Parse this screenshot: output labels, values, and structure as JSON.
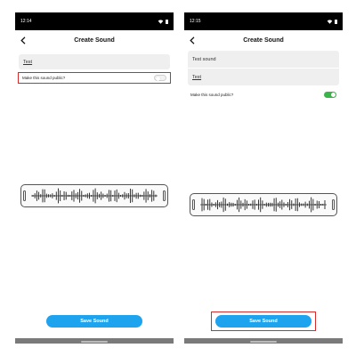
{
  "screens": [
    {
      "status": {
        "time": "12:14"
      },
      "nav": {
        "title": "Create Sound"
      },
      "name_field": {
        "value": "Test"
      },
      "public_toggle": {
        "label": "Make this sound public?",
        "state": "off"
      },
      "save_button": {
        "label": "Save Sound"
      }
    },
    {
      "status": {
        "time": "12:15"
      },
      "nav": {
        "title": "Create Sound"
      },
      "title_field": {
        "value": "Test sound"
      },
      "name_field": {
        "value": "Test"
      },
      "public_toggle": {
        "label": "Make this sound public?",
        "state": "on"
      },
      "save_button": {
        "label": "Save Sound"
      }
    }
  ],
  "colors": {
    "accent_blue": "#1ea4ef",
    "toggle_on": "#3ab54a",
    "highlight_red": "#d62b2b"
  }
}
